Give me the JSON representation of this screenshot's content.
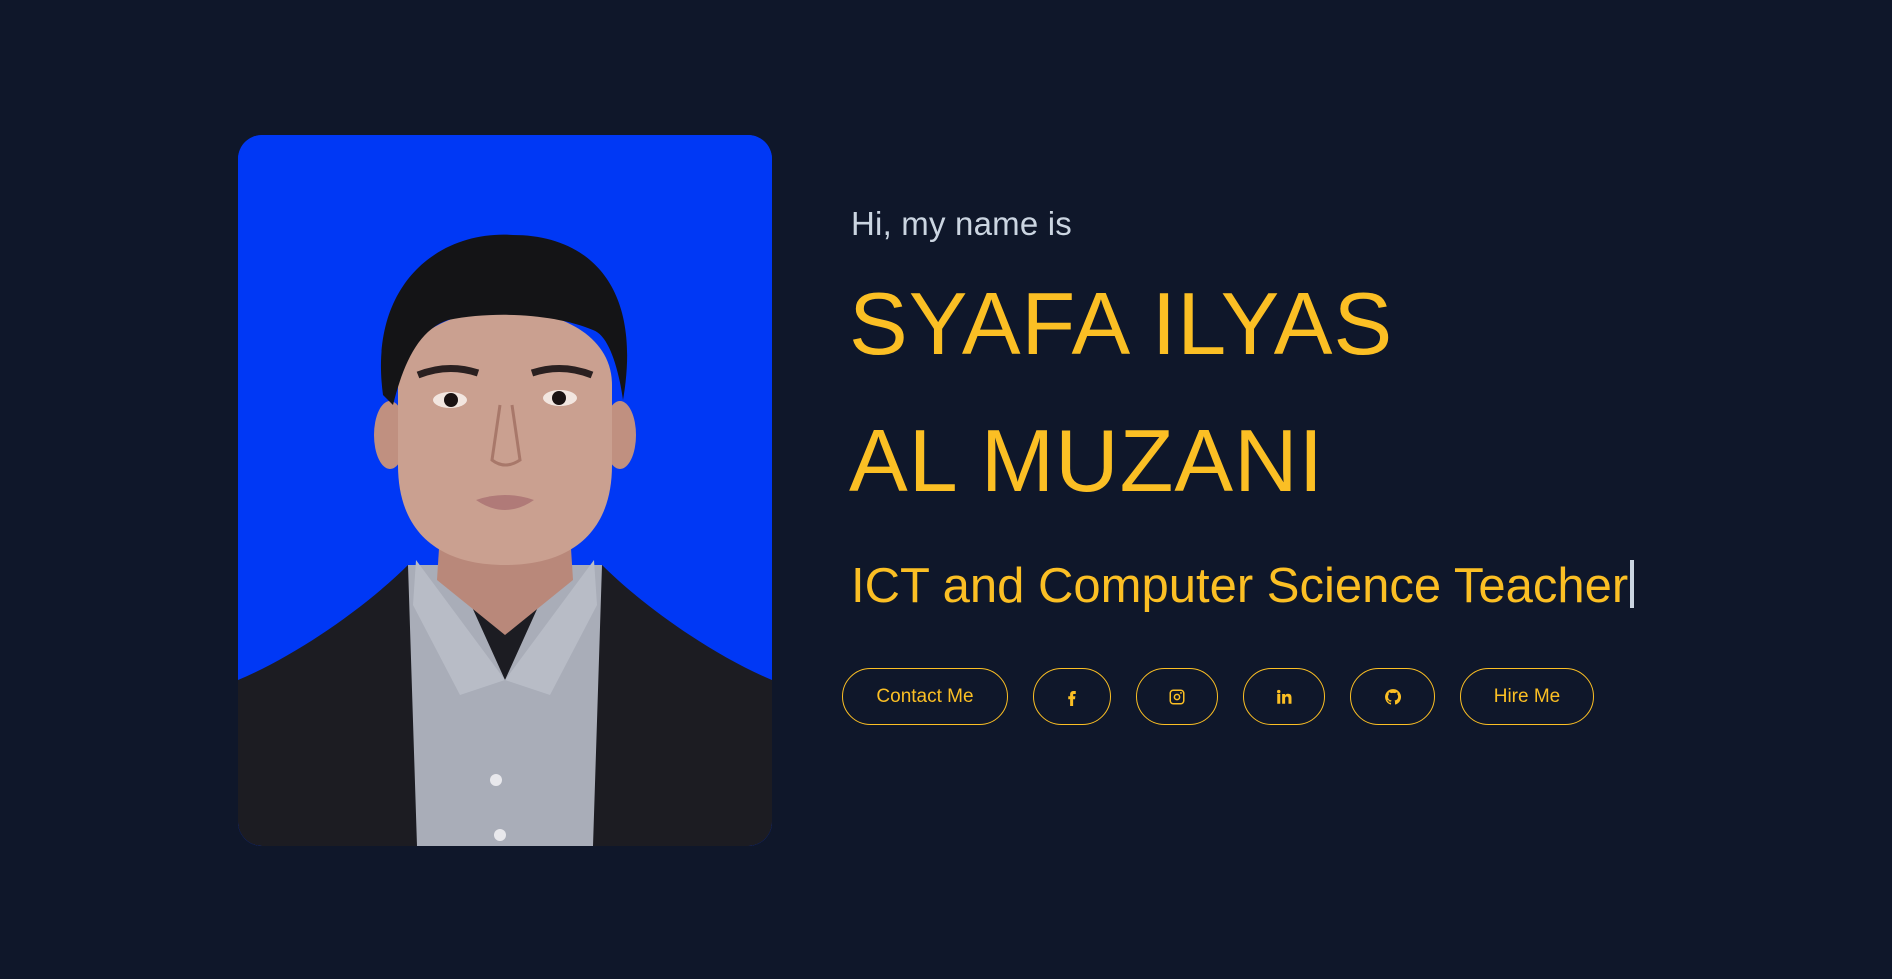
{
  "profile": {
    "intro": "Hi, my name is",
    "name_line_1": "SYAFA ILYAS",
    "name_line_2": "AL MUZANI",
    "role": "ICT and Computer Science Teacher"
  },
  "actions": {
    "contact_label": "Contact Me",
    "hire_label": "Hire Me",
    "social_icons": [
      "facebook-icon",
      "instagram-icon",
      "linkedin-icon",
      "github-icon"
    ]
  },
  "colors": {
    "background": "#0f172a",
    "accent": "#fbbf24",
    "muted_text": "#cbd5e1",
    "photo_background": "#0038f5"
  }
}
